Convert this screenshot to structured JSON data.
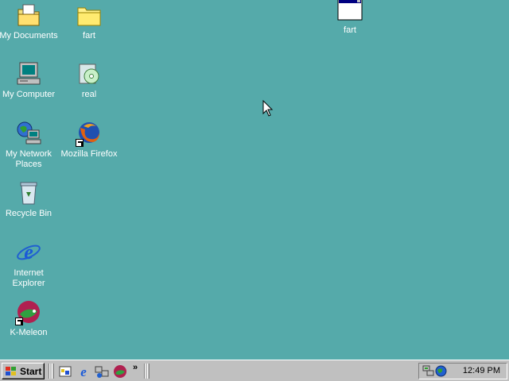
{
  "desktop": {
    "background": "#55aaaa",
    "icons": [
      {
        "label": "My Documents",
        "icon": "folder-documents-icon"
      },
      {
        "label": "fart",
        "icon": "folder-icon"
      },
      {
        "label": "fart",
        "icon": "window-icon"
      },
      {
        "label": "My Computer",
        "icon": "computer-icon"
      },
      {
        "label": "real",
        "icon": "recycle-cd-icon"
      },
      {
        "label": "My Network Places",
        "icon": "network-icon"
      },
      {
        "label": "Mozilla Firefox",
        "icon": "firefox-icon"
      },
      {
        "label": "Recycle Bin",
        "icon": "recycle-bin-icon"
      },
      {
        "label": "Internet Explorer",
        "icon": "ie-icon"
      },
      {
        "label": "K-Meleon",
        "icon": "k-meleon-icon"
      }
    ]
  },
  "taskbar": {
    "start_label": "Start",
    "quick_launch": [
      "show-desktop-icon",
      "ie-icon",
      "network-icon",
      "k-meleon-icon"
    ],
    "more_label": "»",
    "tray_icons": [
      "network-tray-icon",
      "globe-tray-icon"
    ],
    "clock": "12:49 PM"
  }
}
